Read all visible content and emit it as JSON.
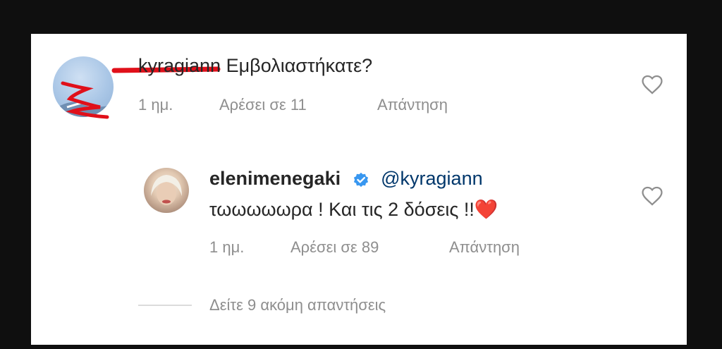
{
  "comment": {
    "username": "kyragiann",
    "text": "Εμβολιαστήκατε?",
    "age": "1 ημ.",
    "likes": "Αρέσει σε 11",
    "reply_label": "Απάντηση"
  },
  "reply": {
    "username": "elenimenegaki",
    "mention": "@kyragiann",
    "text": "τωωωωωρα ! Και τις 2 δόσεις !!",
    "emoji": "❤️",
    "age": "1 ημ.",
    "likes": "Αρέσει σε 89",
    "reply_label": "Απάντηση"
  },
  "more_replies": "Δείτε 9 ακόμη απαντήσεις",
  "colors": {
    "background": "#0f0f0f",
    "card": "#ffffff",
    "text": "#262626",
    "muted": "#8e8e8e",
    "mention": "#00376b",
    "verified": "#3897f0",
    "redaction": "#e0101a"
  },
  "icons": [
    "heart-outline-icon",
    "verified-badge-icon"
  ]
}
